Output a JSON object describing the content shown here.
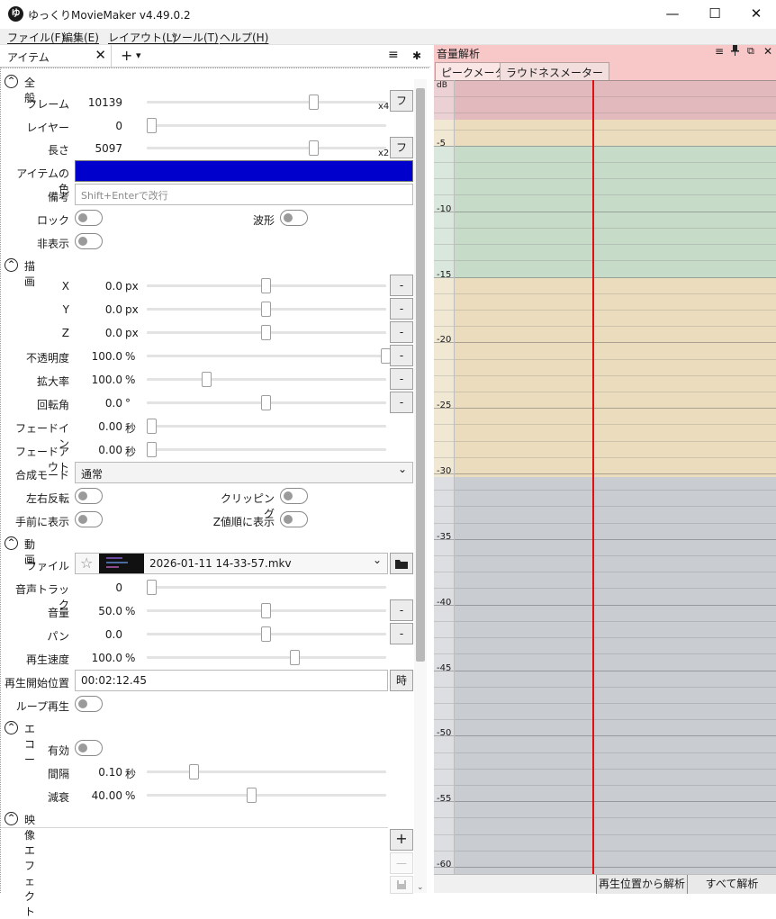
{
  "window": {
    "title": "ゆっくりMovieMaker v4.49.0.2",
    "min": "—",
    "max": "☐",
    "close": "✕"
  },
  "menu": [
    "ファイル(F)",
    "編集(E)",
    "レイアウト(L)",
    "ツール(T)",
    "ヘルプ(H)"
  ],
  "left_tab": {
    "label": "アイテム",
    "close": "✕",
    "add": "+",
    "dropdown": "▾",
    "hamburger": "≡",
    "gear": "✱"
  },
  "sections": {
    "general": "全般",
    "draw": "描画",
    "video": "動画",
    "echo": "エコー",
    "video_effect": "映像エフェクト"
  },
  "general": {
    "frame": {
      "label": "フレーム",
      "value": "10139",
      "mult": "x4",
      "btn": "フ",
      "level": 0.7
    },
    "layer": {
      "label": "レイヤー",
      "value": "0",
      "level": 0.0
    },
    "length": {
      "label": "長さ",
      "value": "5097",
      "mult": "x2",
      "btn": "フ",
      "level": 0.7
    },
    "color": {
      "label": "アイテムの色",
      "value": "#0000cc"
    },
    "note": {
      "label": "備考",
      "placeholder": "Shift+Enterで改行"
    },
    "lock": "ロック",
    "waveform": "波形",
    "hidden": "非表示"
  },
  "draw": {
    "x": {
      "label": "X",
      "value": "0.0",
      "unit": "px",
      "btn": "-",
      "level": 0.5
    },
    "y": {
      "label": "Y",
      "value": "0.0",
      "unit": "px",
      "btn": "-",
      "level": 0.5
    },
    "z": {
      "label": "Z",
      "value": "0.0",
      "unit": "px",
      "btn": "-",
      "level": 0.5
    },
    "opacity": {
      "label": "不透明度",
      "value": "100.0",
      "unit": "%",
      "btn": "-",
      "level": 1.0
    },
    "zoom": {
      "label": "拡大率",
      "value": "100.0",
      "unit": "%",
      "btn": "-",
      "level": 0.25
    },
    "rotation": {
      "label": "回転角",
      "value": "0.0",
      "unit": "°",
      "btn": "-",
      "level": 0.5
    },
    "fadein": {
      "label": "フェードイン",
      "value": "0.00",
      "unit": "秒",
      "level": 0.0
    },
    "fadeout": {
      "label": "フェードアウト",
      "value": "0.00",
      "unit": "秒",
      "level": 0.0
    },
    "blend": {
      "label": "合成モード",
      "value": "通常",
      "arrow": "⌄"
    },
    "flip": "左右反転",
    "clipping": "クリッピング",
    "front": "手前に表示",
    "zorder": "Z値順に表示"
  },
  "video": {
    "file": {
      "label": "ファイル",
      "star": "☆",
      "value": "2026-01-11 14-33-57.mkv",
      "arrow": "⌄"
    },
    "audio_track": {
      "label": "音声トラック",
      "value": "0",
      "level": 0.0
    },
    "volume": {
      "label": "音量",
      "value": "50.0",
      "unit": "%",
      "btn": "-",
      "level": 0.5
    },
    "pan": {
      "label": "パン",
      "value": "0.0",
      "btn": "-",
      "level": 0.5
    },
    "speed": {
      "label": "再生速度",
      "value": "100.0",
      "unit": "%",
      "level": 0.62
    },
    "start": {
      "label": "再生開始位置",
      "value": "00:02:12.45",
      "btn": "時"
    },
    "loop": "ループ再生"
  },
  "echo": {
    "enabled": "有効",
    "interval": {
      "label": "間隔",
      "value": "0.10",
      "unit": "秒",
      "level": 0.2
    },
    "decay": {
      "label": "減衰",
      "value": "40.00",
      "unit": "%",
      "level": 0.44
    }
  },
  "effects": {
    "add": "+",
    "remove": "—"
  },
  "meter": {
    "title": "音量解析",
    "tabs": [
      "ピークメーター",
      "ラウドネスメーター"
    ],
    "unit_label": "dB",
    "ticks": [
      "-5",
      "-10",
      "-15",
      "-20",
      "-25",
      "-30",
      "-35",
      "-40",
      "-45",
      "-50",
      "-55",
      "-60"
    ],
    "cursor_color": "#e01010",
    "bands": {
      "red": "#e2b9bd",
      "yellow": "#eadcbd",
      "green": "#c7dbc9",
      "gray": "#c9ccd1"
    },
    "btn_analyze_from": "再生位置から解析",
    "btn_analyze_all": "すべて解析",
    "panel_icons": {
      "menu": "≡",
      "pin": "📌",
      "float": "⧉",
      "close": "✕"
    }
  }
}
